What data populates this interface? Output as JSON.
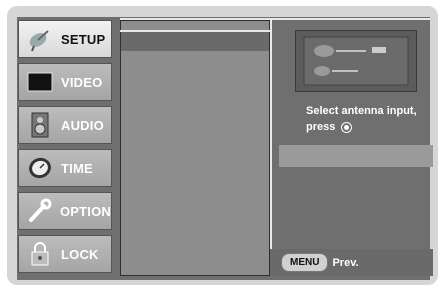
{
  "sidebar": {
    "items": [
      {
        "label": "SETUP",
        "icon": "satellite-icon",
        "active": true
      },
      {
        "label": "VIDEO",
        "icon": "tv-screen-icon",
        "active": false
      },
      {
        "label": "AUDIO",
        "icon": "speaker-icon",
        "active": false
      },
      {
        "label": "TIME",
        "icon": "clock-icon",
        "active": false
      },
      {
        "label": "OPTION",
        "icon": "wrench-icon",
        "active": false
      },
      {
        "label": "LOCK",
        "icon": "padlock-icon",
        "active": false
      }
    ]
  },
  "right_panel": {
    "prompt_line1": "Select antenna input,",
    "prompt_line2": "press"
  },
  "bottom_bar": {
    "menu_button": "MENU",
    "prev_label": "Prev."
  },
  "colors": {
    "panel_bg": "#6f6f6f",
    "sidebar_active": "#f2f2f2",
    "sidebar_inactive": "#b3b3b3",
    "text_light": "#ffffff"
  }
}
